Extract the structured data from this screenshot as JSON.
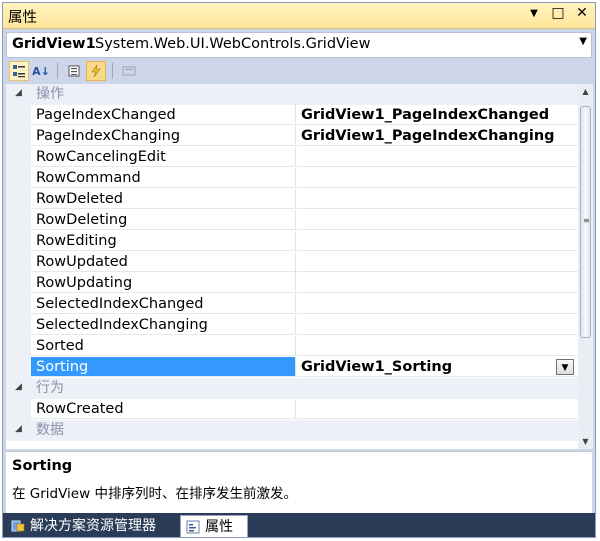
{
  "window": {
    "title": "属性"
  },
  "title_buttons": {
    "dropdown": "▼",
    "maximize": "□",
    "close": "✕"
  },
  "object_selector": {
    "name": "GridView1",
    "type": "System.Web.UI.WebControls.GridView"
  },
  "toolbar": {
    "buttons": [
      {
        "icon": "categorized-icon",
        "glyph": "▤"
      },
      {
        "icon": "alphabetical-icon",
        "glyph": "A↓"
      },
      {
        "icon": "properties-icon",
        "glyph": "≣"
      },
      {
        "icon": "events-icon",
        "glyph": "⚡"
      },
      {
        "icon": "property-pages-icon",
        "glyph": "▭"
      }
    ]
  },
  "grid": {
    "categories": [
      {
        "label": "操作"
      },
      {
        "label": "行为"
      },
      {
        "label": "数据"
      }
    ],
    "action_events": [
      {
        "name": "PageIndexChanged",
        "value": "GridView1_PageIndexChanged"
      },
      {
        "name": "PageIndexChanging",
        "value": "GridView1_PageIndexChanging"
      },
      {
        "name": "RowCancelingEdit",
        "value": ""
      },
      {
        "name": "RowCommand",
        "value": ""
      },
      {
        "name": "RowDeleted",
        "value": ""
      },
      {
        "name": "RowDeleting",
        "value": ""
      },
      {
        "name": "RowEditing",
        "value": ""
      },
      {
        "name": "RowUpdated",
        "value": ""
      },
      {
        "name": "RowUpdating",
        "value": ""
      },
      {
        "name": "SelectedIndexChanged",
        "value": ""
      },
      {
        "name": "SelectedIndexChanging",
        "value": ""
      },
      {
        "name": "Sorted",
        "value": ""
      },
      {
        "name": "Sorting",
        "value": "GridView1_Sorting"
      }
    ],
    "behavior_events": [
      {
        "name": "RowCreated",
        "value": ""
      }
    ]
  },
  "description": {
    "title": "Sorting",
    "text": "在 GridView 中排序列时、在排序发生前激发。"
  },
  "tabs": [
    {
      "label": "解决方案资源管理器",
      "icon": "solution-explorer-icon"
    },
    {
      "label": "属性",
      "icon": "properties-window-icon"
    }
  ],
  "colors": {
    "selection": "#3399ff",
    "tab_bar": "#2b3c59",
    "titlebar": "#ffe59a"
  }
}
